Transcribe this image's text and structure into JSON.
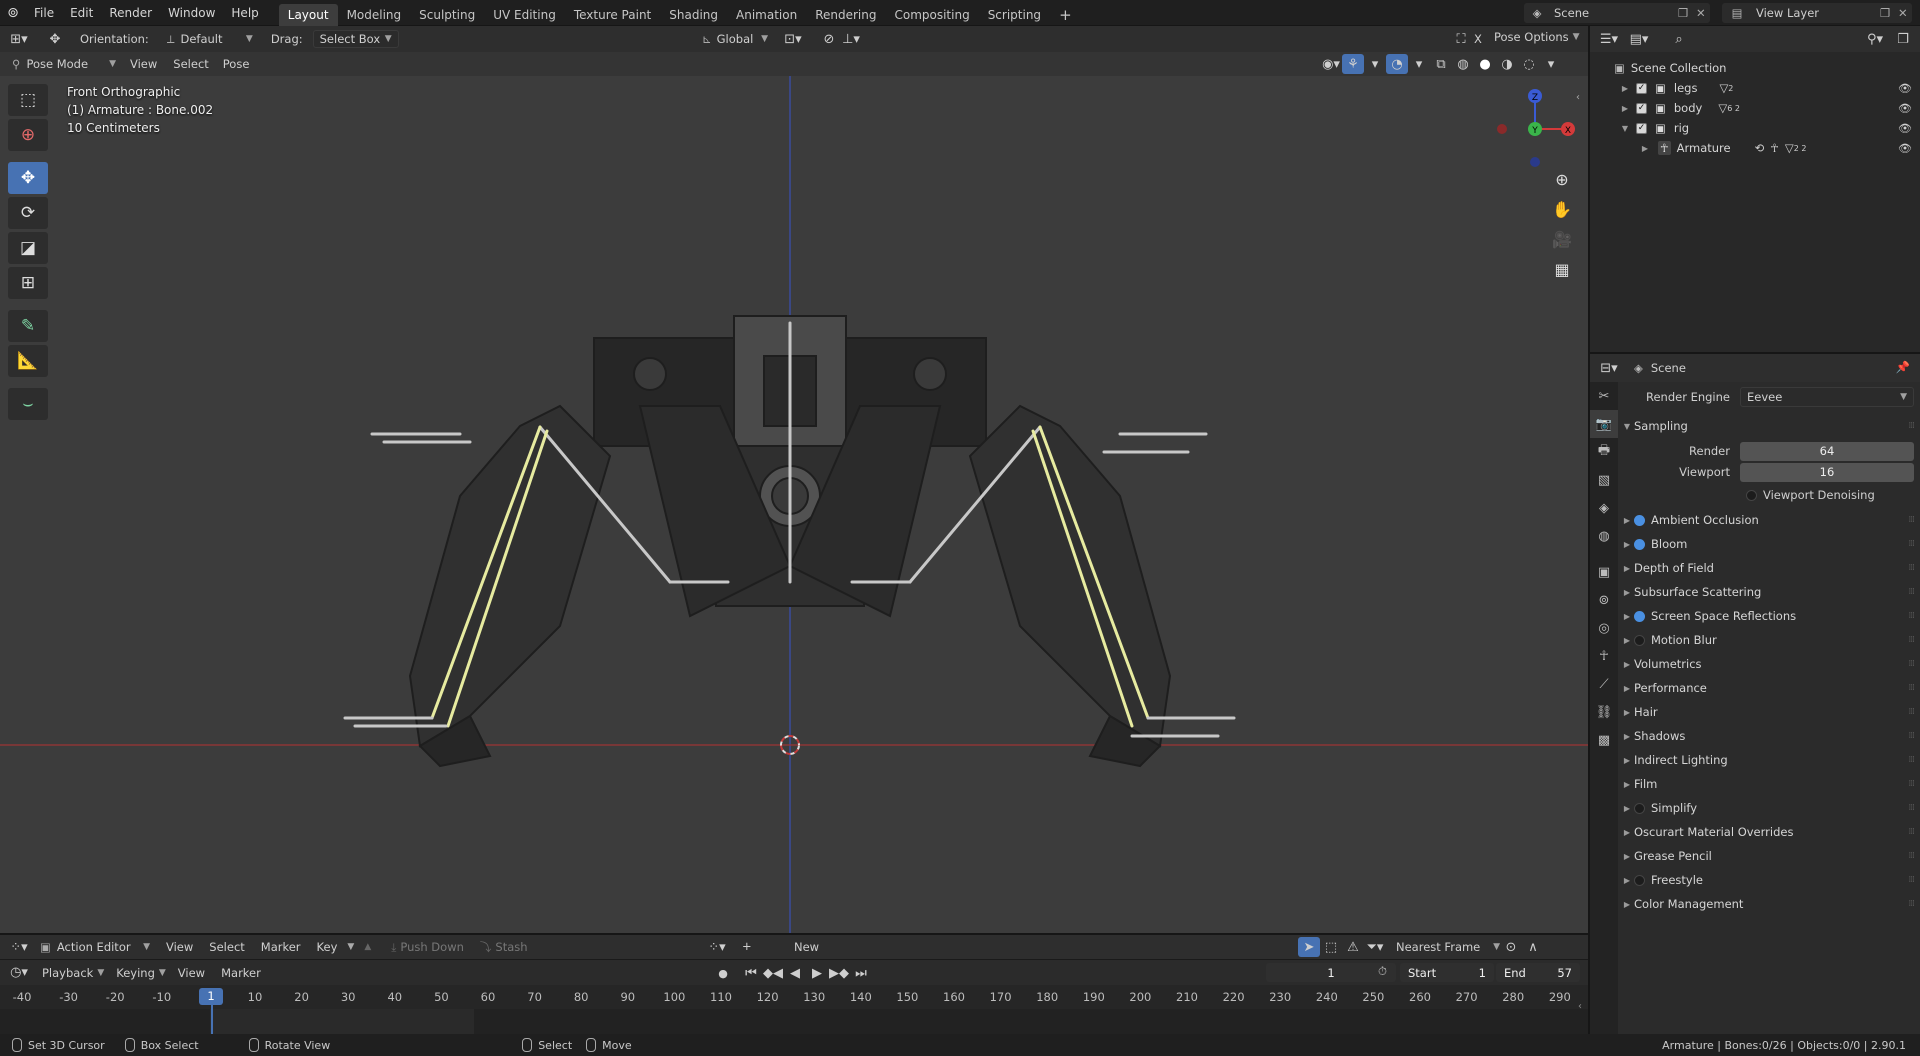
{
  "topbar": {
    "menus": [
      "File",
      "Edit",
      "Render",
      "Window",
      "Help"
    ],
    "workspaces": [
      "Layout",
      "Modeling",
      "Sculpting",
      "UV Editing",
      "Texture Paint",
      "Shading",
      "Animation",
      "Rendering",
      "Compositing",
      "Scripting"
    ],
    "active_workspace": "Layout",
    "add_tab": "+",
    "scene": "Scene",
    "view_layer": "View Layer"
  },
  "viewport_header": {
    "orientation_label": "Orientation:",
    "orientation_value": "Default",
    "drag_label": "Drag:",
    "drag_value": "Select Box",
    "transform_orientation": "Global",
    "options_close": "X",
    "pose_options": "Pose Options",
    "mode": "Pose Mode",
    "menus": [
      "View",
      "Select",
      "Pose"
    ]
  },
  "viewport_info": {
    "view_name": "Front Orthographic",
    "active": "(1) Armature : Bone.002",
    "scale": "10 Centimeters"
  },
  "gizmo": {
    "z": "Z",
    "y": "Y",
    "x": "X"
  },
  "outliner": {
    "root": "Scene Collection",
    "items": [
      {
        "name": "legs",
        "badge": "2"
      },
      {
        "name": "body",
        "badge": "6 2"
      },
      {
        "name": "rig",
        "badge": ""
      },
      {
        "name": "Armature",
        "badge": "2 2"
      }
    ]
  },
  "properties": {
    "header": "Scene",
    "render_engine_label": "Render Engine",
    "render_engine_value": "Eevee",
    "sampling": {
      "title": "Sampling",
      "render_label": "Render",
      "render_value": "64",
      "viewport_label": "Viewport",
      "viewport_value": "16",
      "denoising": "Viewport Denoising"
    },
    "panels": [
      {
        "label": "Ambient Occlusion",
        "toggle": "on"
      },
      {
        "label": "Bloom",
        "toggle": "on"
      },
      {
        "label": "Depth of Field",
        "toggle": "none"
      },
      {
        "label": "Subsurface Scattering",
        "toggle": "none"
      },
      {
        "label": "Screen Space Reflections",
        "toggle": "on"
      },
      {
        "label": "Motion Blur",
        "toggle": "off"
      },
      {
        "label": "Volumetrics",
        "toggle": "none"
      },
      {
        "label": "Performance",
        "toggle": "none"
      },
      {
        "label": "Hair",
        "toggle": "none"
      },
      {
        "label": "Shadows",
        "toggle": "none"
      },
      {
        "label": "Indirect Lighting",
        "toggle": "none"
      },
      {
        "label": "Film",
        "toggle": "none"
      },
      {
        "label": "Simplify",
        "toggle": "off"
      },
      {
        "label": "Oscurart Material Overrides",
        "toggle": "none"
      },
      {
        "label": "Grease Pencil",
        "toggle": "none"
      },
      {
        "label": "Freestyle",
        "toggle": "off"
      },
      {
        "label": "Color Management",
        "toggle": "none"
      }
    ]
  },
  "action_editor": {
    "editor_type": "Action Editor",
    "menus": [
      "View",
      "Select",
      "Marker",
      "Key"
    ],
    "push_down": "Push Down",
    "stash": "Stash",
    "new": "New",
    "snap": "Nearest Frame"
  },
  "timeline_header": {
    "menus": [
      "Playback",
      "Keying",
      "View",
      "Marker"
    ],
    "current_frame": "1",
    "start_label": "Start",
    "start_value": "1",
    "end_label": "End",
    "end_value": "57"
  },
  "timeline": {
    "ticks": [
      "-40",
      "-30",
      "-20",
      "-10",
      "1",
      "10",
      "20",
      "30",
      "40",
      "50",
      "60",
      "70",
      "80",
      "90",
      "100",
      "110",
      "120",
      "130",
      "140",
      "150",
      "160",
      "170",
      "180",
      "190",
      "200",
      "210",
      "220",
      "230",
      "240",
      "250",
      "260",
      "270",
      "280",
      "290"
    ],
    "playhead": "1"
  },
  "statusbar": {
    "items": [
      "Set 3D Cursor",
      "Box Select",
      "Rotate View",
      "Select",
      "Move"
    ],
    "right": "Armature | Bones:0/26 | Objects:0/0 | 2.90.1"
  },
  "colors": {
    "accent": "#4772b3",
    "bone_selected": "#e7eba0",
    "bone": "#c8c8c8",
    "x_axis": "#b33a3a",
    "z_axis": "#3a4fb3"
  }
}
